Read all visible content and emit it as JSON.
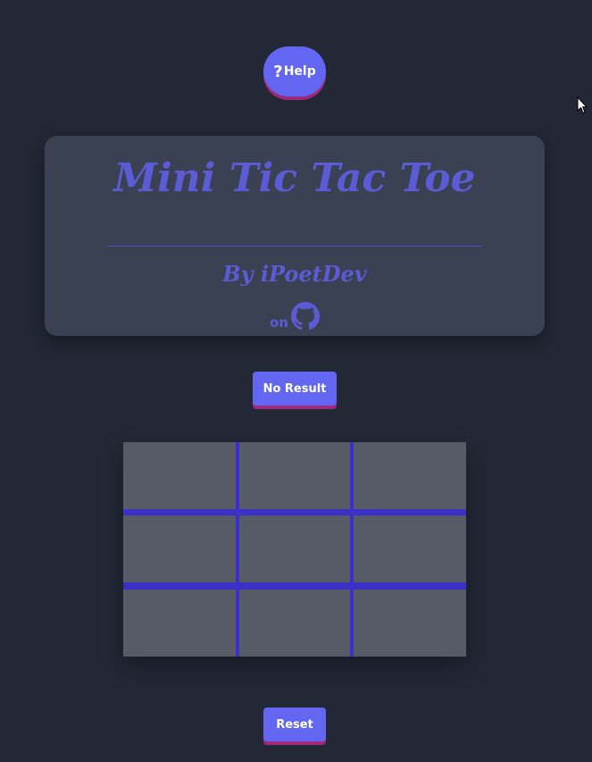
{
  "help_button": {
    "icon": "?",
    "label": "Help"
  },
  "header": {
    "title": "Mini Tic Tac Toe",
    "byline": "By iPoetDev",
    "on_label": "on",
    "github_icon": "github-icon"
  },
  "status": {
    "result_label": "No Result"
  },
  "board": {
    "cells": [
      "",
      "",
      "",
      "",
      "",
      "",
      "",
      "",
      ""
    ]
  },
  "controls": {
    "reset_label": "Reset"
  },
  "colors": {
    "background": "#222836",
    "card": "#394152",
    "accent": "#6366f1",
    "board_lines": "#3b30c8",
    "cell": "#575b66"
  }
}
